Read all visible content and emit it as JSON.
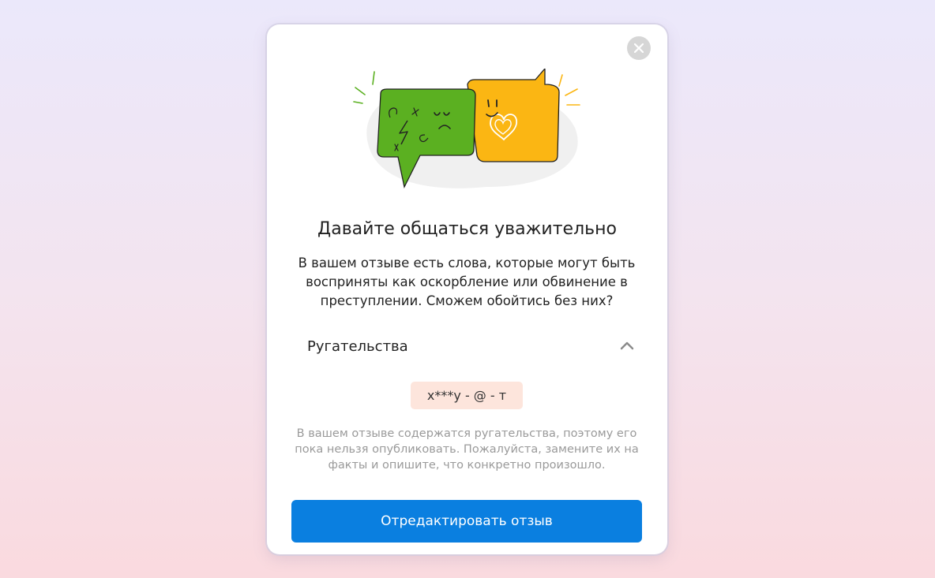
{
  "dialog": {
    "title": "Давайте общаться уважительно",
    "message": "В вашем отзыве есть слова, которые могут быть восприняты как оскорбление или обвинение в преступлении. Сможем обойтись без них?",
    "section": {
      "label": "Ругательства",
      "state": "expanded",
      "flagged_words": "х***у - @ - т"
    },
    "hint": "В вашем отзыве содержатся ругательства, поэтому его пока нельзя опубликовать. Пожалуйста, замените их на факты и опишите, что конкретно произошло.",
    "primary_button": "Отредактировать отзыв",
    "icons": {
      "close": "close-icon",
      "chevron": "chevron-up-icon",
      "illustration": "angry-and-happy-speech-bubbles"
    }
  },
  "colors": {
    "primary": "#0a7fe0",
    "badge_bg": "#fde5dc",
    "bubble_green": "#5bb021",
    "bubble_yellow": "#fbb613"
  }
}
